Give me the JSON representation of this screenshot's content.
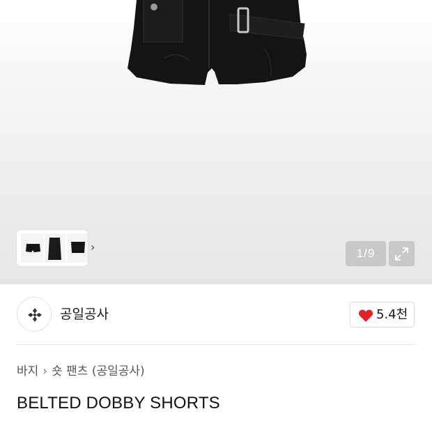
{
  "gallery": {
    "page_indicator": "1/9",
    "thumb_next": "›"
  },
  "brand": {
    "name": "공일공사"
  },
  "like": {
    "count": "5.4천",
    "color": "#e0242b"
  },
  "breadcrumb": {
    "items": [
      "바지",
      "숏 팬츠 (공일공사)"
    ],
    "separator": "›"
  },
  "product": {
    "title": "BELTED DOBBY SHORTS"
  }
}
